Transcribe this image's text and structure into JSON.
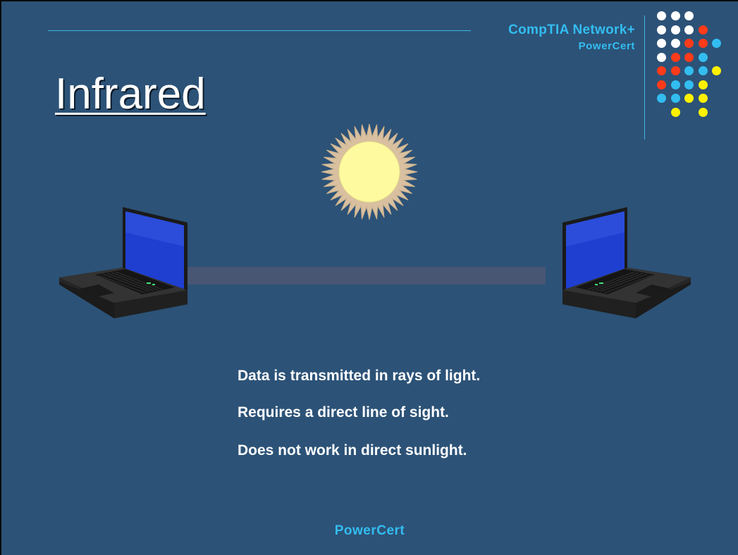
{
  "header": {
    "brand_title": "CompTIA Network+",
    "brand_sub": "PowerCert"
  },
  "slide": {
    "title": "Infrared",
    "bullets": [
      "Data is transmitted in rays of light.",
      "Requires a direct line of sight.",
      "Does not work in direct sunlight."
    ]
  },
  "footer": {
    "text": "PowerCert"
  },
  "colors": {
    "background": "#2c5277",
    "accent": "#33bdf0",
    "dot_white": "#ffffff",
    "dot_red": "#ff3b1a",
    "dot_blue": "#33bdf0",
    "dot_yellow": "#fff200"
  },
  "decor": {
    "icons": [
      "sun-icon",
      "laptop-icon",
      "infrared-beam",
      "dot-grid"
    ],
    "dot_rows": [
      [
        "white",
        "white",
        "white"
      ],
      [
        "white",
        "white",
        "white",
        "red"
      ],
      [
        "white",
        "white",
        "red",
        "red",
        "blue"
      ],
      [
        "white",
        "red",
        "red",
        "blue"
      ],
      [
        "red",
        "red",
        "blue",
        "blue",
        "yellow"
      ],
      [
        "red",
        "blue",
        "blue",
        "yellow"
      ],
      [
        "blue",
        "blue",
        "yellow",
        "yellow"
      ],
      [
        "",
        "yellow",
        "",
        "yellow"
      ]
    ]
  }
}
